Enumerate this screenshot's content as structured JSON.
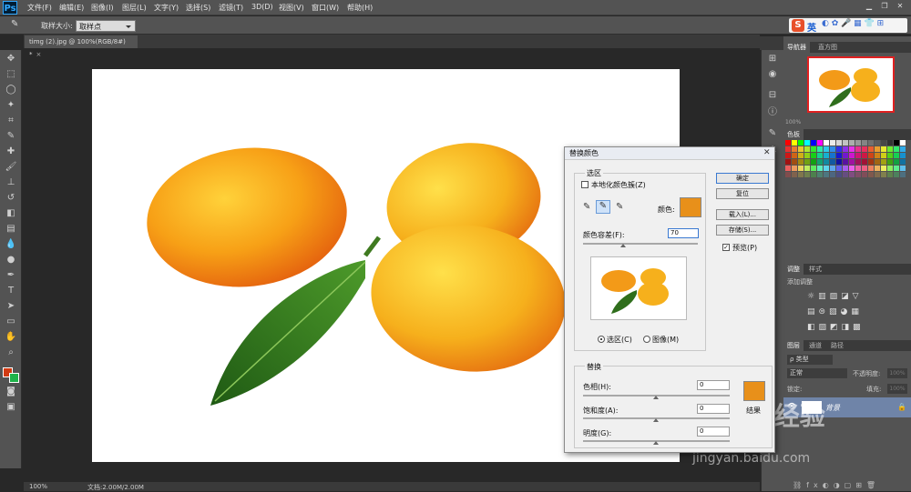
{
  "app": {
    "logo": "Ps",
    "menus": [
      "文件(F)",
      "编辑(E)",
      "图像(I)",
      "图层(L)",
      "文字(Y)",
      "选择(S)",
      "滤镜(T)",
      "3D(D)",
      "视图(V)",
      "窗口(W)",
      "帮助(H)"
    ],
    "ime_label": "英"
  },
  "options": {
    "sample_size_label": "取样大小:",
    "sample_size_value": "取样点"
  },
  "document": {
    "tab_title": "timg (2).jpg @ 100%(RGB/8#) *",
    "zoom": "100%",
    "doc_info": "文档:2.00M/2.00M"
  },
  "panels": {
    "navigator_tabs": [
      "导航器",
      "直方图"
    ],
    "navigator_zoom": "100%",
    "swatches_tab": "色板",
    "adjustments_tabs": [
      "调整",
      "样式"
    ],
    "adjustments_title": "添加调整",
    "layers_tabs": [
      "图层",
      "通道",
      "路径"
    ],
    "layer_kind": "ρ 类型",
    "blend_mode": "正常",
    "opacity_label": "不透明度:",
    "opacity_value": "100%",
    "lock_label": "锁定:",
    "fill_label": "填充:",
    "fill_value": "100%",
    "layer_name": "背景"
  },
  "dialog": {
    "title": "替换颜色",
    "selection_group": "选区",
    "localized_clusters": "本地化颜色簇(Z)",
    "color_label": "颜色:",
    "fuzziness_label": "颜色容差(F):",
    "fuzziness_value": "70",
    "radio_selection": "选区(C)",
    "radio_image": "图像(M)",
    "replace_group": "替换",
    "hue_label": "色相(H):",
    "hue_value": "0",
    "saturation_label": "饱和度(A):",
    "saturation_value": "0",
    "lightness_label": "明度(G):",
    "lightness_value": "0",
    "result_label": "结果",
    "ok": "确定",
    "reset": "复位",
    "load": "载入(L)...",
    "save": "存储(S)...",
    "preview": "预览(P)",
    "selected_color": "#e8901a"
  },
  "watermark": {
    "brand": "Baidu经验",
    "url": "jingyan.baidu.com"
  }
}
